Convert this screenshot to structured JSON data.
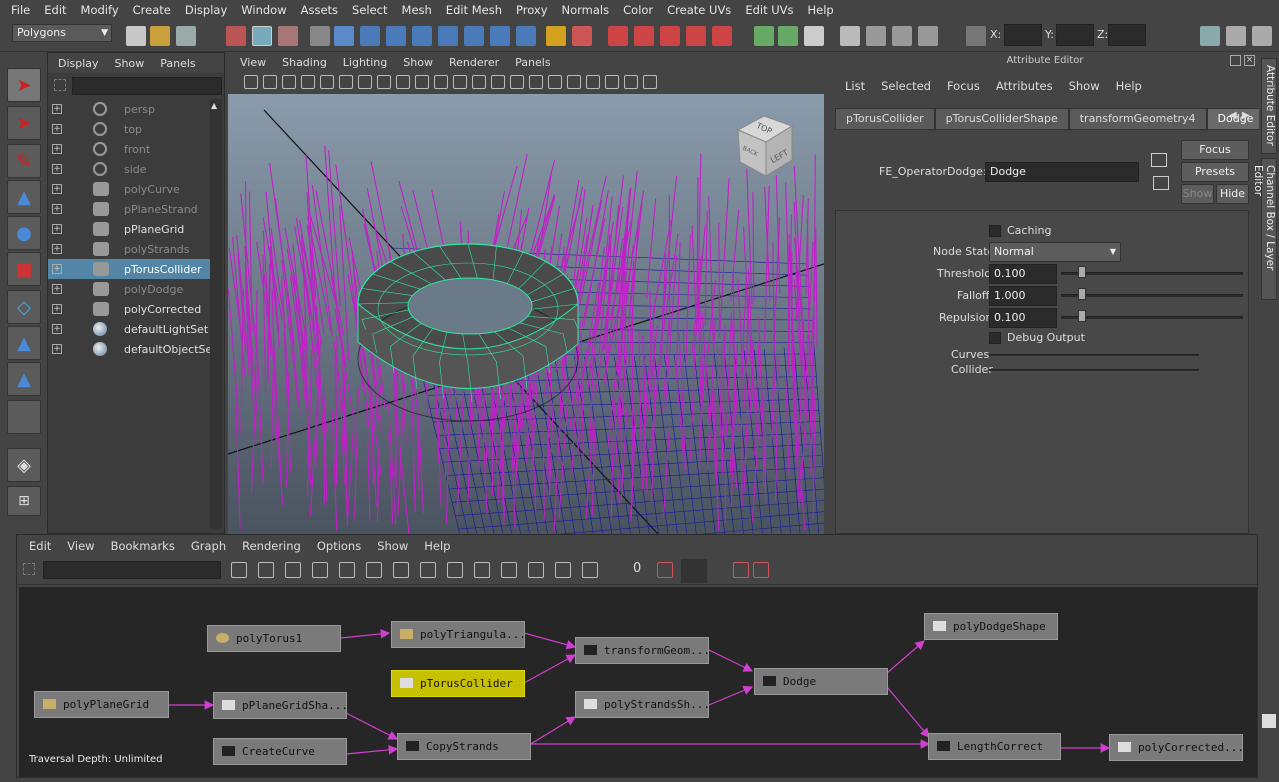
{
  "menubar": [
    "File",
    "Edit",
    "Modify",
    "Create",
    "Display",
    "Window",
    "Assets",
    "Select",
    "Mesh",
    "Edit Mesh",
    "Proxy",
    "Normals",
    "Color",
    "Create UVs",
    "Edit UVs",
    "Help"
  ],
  "statusline": {
    "mode": "Polygons",
    "x_label": "X:",
    "y_label": "Y:",
    "z_label": "Z:"
  },
  "outliner": {
    "menu": [
      "Display",
      "Show",
      "Panels"
    ],
    "items": [
      {
        "label": "persp",
        "dim": true,
        "icon": "camera-icon"
      },
      {
        "label": "top",
        "dim": true,
        "icon": "camera-icon"
      },
      {
        "label": "front",
        "dim": true,
        "icon": "camera-icon"
      },
      {
        "label": "side",
        "dim": true,
        "icon": "camera-icon"
      },
      {
        "label": "polyCurve",
        "dim": true,
        "icon": "mesh-icon"
      },
      {
        "label": "pPlaneStrand",
        "dim": true,
        "icon": "mesh-icon"
      },
      {
        "label": "pPlaneGrid",
        "dim": false,
        "icon": "mesh-icon"
      },
      {
        "label": "polyStrands",
        "dim": true,
        "icon": "mesh-icon"
      },
      {
        "label": "pTorusCollider",
        "dim": false,
        "icon": "mesh-icon",
        "selected": true
      },
      {
        "label": "polyDodge",
        "dim": true,
        "icon": "mesh-icon"
      },
      {
        "label": "polyCorrected",
        "dim": false,
        "icon": "mesh-icon"
      },
      {
        "label": "defaultLightSet",
        "dim": false,
        "icon": "set-icon"
      },
      {
        "label": "defaultObjectSet",
        "dim": false,
        "icon": "set-icon"
      }
    ]
  },
  "viewport": {
    "menu": [
      "View",
      "Shading",
      "Lighting",
      "Show",
      "Renderer",
      "Panels"
    ],
    "cube_top": "TOP",
    "cube_left": "LEFT",
    "cube_back": "BACK"
  },
  "attr": {
    "title": "Attribute Editor",
    "menu": [
      "List",
      "Selected",
      "Focus",
      "Attributes",
      "Show",
      "Help"
    ],
    "tabs": [
      "pTorusCollider",
      "pTorusColliderShape",
      "transformGeometry4",
      "Dodge"
    ],
    "node_label": "FE_OperatorDodge:",
    "node_value": "Dodge",
    "focus": "Focus",
    "presets": "Presets",
    "show": "Show",
    "hide": "Hide",
    "caching": "Caching",
    "node_state_label": "Node State",
    "node_state": "Normal",
    "threshold_label": "Threshold",
    "threshold": "0.100",
    "falloff_label": "Falloff",
    "falloff": "1.000",
    "repulsion_label": "Repulsion",
    "repulsion": "0.100",
    "debug": "Debug Output",
    "curves": "Curves",
    "collider": "Collider"
  },
  "sidetabs": [
    "Attribute Editor",
    "Channel Box / Layer Editor"
  ],
  "node_editor": {
    "menu": [
      "Edit",
      "View",
      "Bookmarks",
      "Graph",
      "Rendering",
      "Options",
      "Show",
      "Help"
    ],
    "nodes": {
      "polyTorus": "polyTorus1",
      "polyTriangulate": "polyTriangula...",
      "pTorusCollider": "pTorusCollider",
      "transformGeom": "transformGeom...",
      "polyStrandsShape": "polyStrandsSh...",
      "dodge": "Dodge",
      "polyDodgeShape": "polyDodgeShape",
      "polyPlaneGrid": "polyPlaneGrid",
      "pPlaneGridShape": "pPlaneGridSha...",
      "createCurve": "CreateCurve",
      "copyStrands": "CopyStrands",
      "lengthCorrect": "LengthCorrect",
      "polyCorrected": "polyCorrected..."
    },
    "traversal": "Traversal Depth: Unlimited",
    "toolbar_counter": "0"
  },
  "colors": {
    "selection": "#5285a6",
    "strand": "#cc22cc",
    "torus_wire": "#2ee8a0",
    "node_highlight": "#c7c000",
    "connection": "#d040d0"
  }
}
